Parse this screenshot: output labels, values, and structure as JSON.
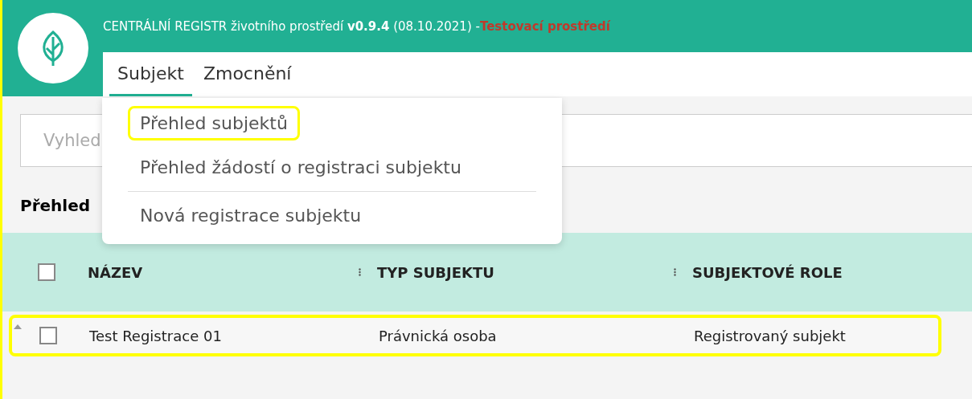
{
  "header": {
    "title": "CENTRÁLNÍ REGISTR životního prostředí **v0.9.4** (08.10.2021) - ",
    "environment": "Testovací prostředí"
  },
  "nav": [
    {
      "label": "Subjekt",
      "selected": true
    },
    {
      "label": "Zmocnění",
      "selected": false
    }
  ],
  "menu": {
    "items": [
      {
        "label": "Přehled subjektů",
        "highlighted": true,
        "divider_before": false
      },
      {
        "label": "Přehled žádostí o registraci subjektu",
        "highlighted": false,
        "divider_before": false
      },
      {
        "label": "Nová registrace subjektu",
        "highlighted": false,
        "divider_before": true
      }
    ]
  },
  "search": {
    "placeholder": "Vyhled"
  },
  "section_title": "Přehled",
  "table": {
    "columns": [
      "NÁZEV",
      "TYP SUBJEKTU",
      "SUBJEKTOVÉ ROLE"
    ],
    "rows": [
      {
        "cells": [
          "Test Registrace 01",
          "Právnická osoba",
          "Registrovaný subjekt"
        ],
        "checked": false,
        "highlighted": true
      }
    ],
    "header_checked": false
  }
}
